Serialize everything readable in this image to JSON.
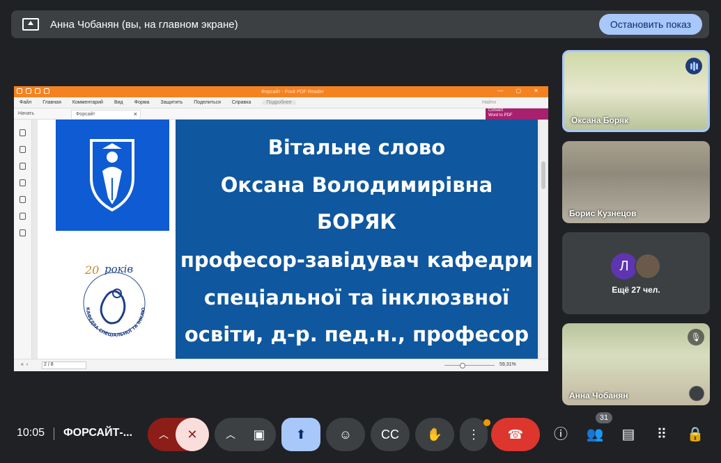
{
  "presenting_bar": {
    "text": "Анна Чобанян (вы, на главном экране)",
    "stop_label": "Остановить показ"
  },
  "shared_screen": {
    "window_title": "Форсайт - Foxit PDF Reader",
    "menu": [
      "Файл",
      "Главная",
      "Комментарий",
      "Вид",
      "Форма",
      "Защитить",
      "Поделиться",
      "Справка"
    ],
    "tell_me": "Подробнее",
    "find_placeholder": "Найти",
    "convert_line1": "Convert",
    "convert_line2": "Word to PDF",
    "tabs": [
      "Начать",
      "Форсайт"
    ],
    "slide_lines": [
      "Вітальне слово",
      "Оксана Володимирівна",
      "БОРЯК",
      "професор-завідувач кафедри",
      "спеціальної та інклюзвної",
      "освіти, д-р. пед.н., професор"
    ],
    "badge_number": "20",
    "badge_word": "років",
    "badge_ring": "КАФЕДРА СПЕЦІАЛЬНОЇ ТА ІНКЛЮЗИВНОЇ ОСВІТИ",
    "page_indicator": "2 / 8",
    "zoom": "59,31%"
  },
  "participants": {
    "p1_name": "Оксана Боряк",
    "p2_name": "Борис Кузнецов",
    "p3_avatar_letter": "Л",
    "p3_more": "Ещё 27 чел.",
    "p4_name": "Анна Чобанян"
  },
  "bottom_bar": {
    "time": "10:05",
    "meeting_name": "ФОРСАЙТ-...",
    "people_count": "31"
  },
  "colors": {
    "background": "#202124",
    "present_active": "#a8c7fa",
    "leave": "#dc362e",
    "foxit_orange": "#f58220",
    "slide_blue": "#0f579e"
  }
}
